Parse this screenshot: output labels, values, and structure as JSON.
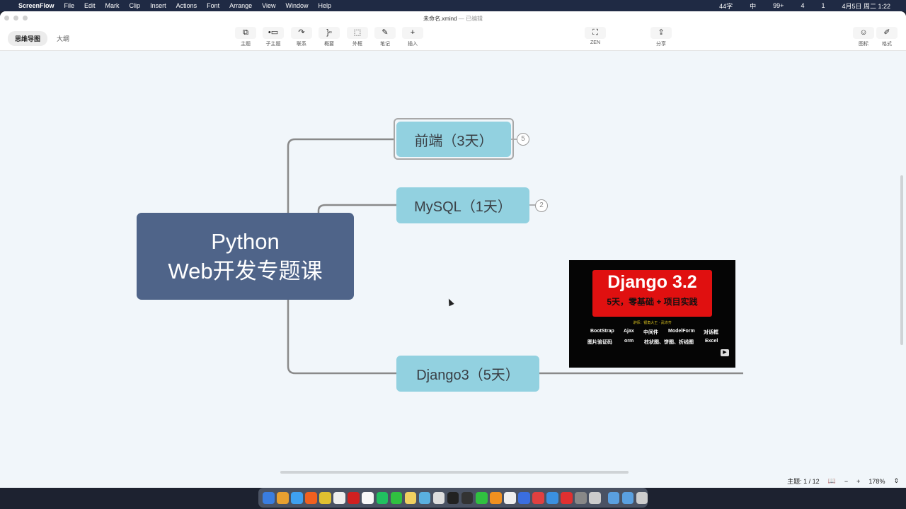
{
  "menubar": {
    "app": "ScreenFlow",
    "items": [
      "File",
      "Edit",
      "Mark",
      "Clip",
      "Insert",
      "Actions",
      "Font",
      "Arrange",
      "View",
      "Window",
      "Help"
    ],
    "status": [
      "44字",
      "中",
      "99+",
      "4",
      "1",
      "4月5日 周二 1:22"
    ]
  },
  "window": {
    "title": "未命名.xmind",
    "subtitle": "— 已编辑"
  },
  "view_tabs": [
    "思维导图",
    "大纲"
  ],
  "tools": [
    {
      "icon": "topic-icon",
      "glyph": "⧉",
      "label": "主题"
    },
    {
      "icon": "subtopic-icon",
      "glyph": "•▭",
      "label": "子主题"
    },
    {
      "icon": "relationship-icon",
      "glyph": "↷",
      "label": "联系"
    },
    {
      "icon": "summary-icon",
      "glyph": "}▫",
      "label": "概要"
    },
    {
      "icon": "boundary-icon",
      "glyph": "⬚",
      "label": "外框"
    },
    {
      "icon": "note-icon",
      "glyph": "✎",
      "label": "笔记"
    },
    {
      "icon": "insert-icon",
      "glyph": "+",
      "label": "插入"
    },
    {
      "icon": "zen-icon",
      "glyph": "⛶",
      "label": "ZEN"
    },
    {
      "icon": "share-icon",
      "glyph": "⇪",
      "label": "分享"
    },
    {
      "icon": "sticker-icon",
      "glyph": "☺",
      "label": "图标"
    },
    {
      "icon": "format-icon",
      "glyph": "✐",
      "label": "格式"
    }
  ],
  "mindmap": {
    "central": [
      "Python",
      "Web开发专题课"
    ],
    "branches": [
      {
        "label": "前端（3天）",
        "count": "5"
      },
      {
        "label": "MySQL（1天）",
        "count": "2"
      },
      {
        "label": "Django3（5天）"
      }
    ]
  },
  "thumbnail": {
    "title": "Django 3.2",
    "subtitle": "5天，零基础 + 项目实践",
    "lecturer": "讲师：银角大王 · 武沛齐",
    "row1": [
      "BootStrap",
      "Ajax",
      "中间件",
      "ModelForm",
      "对话框"
    ],
    "row2": [
      "图片验证码",
      "orm",
      "柱状图、饼图、折线图",
      "Excel"
    ]
  },
  "footer": {
    "topics": "主题: 1 / 12",
    "zoom": "178%",
    "minus": "−",
    "plus": "+",
    "stepper": "⇕"
  }
}
